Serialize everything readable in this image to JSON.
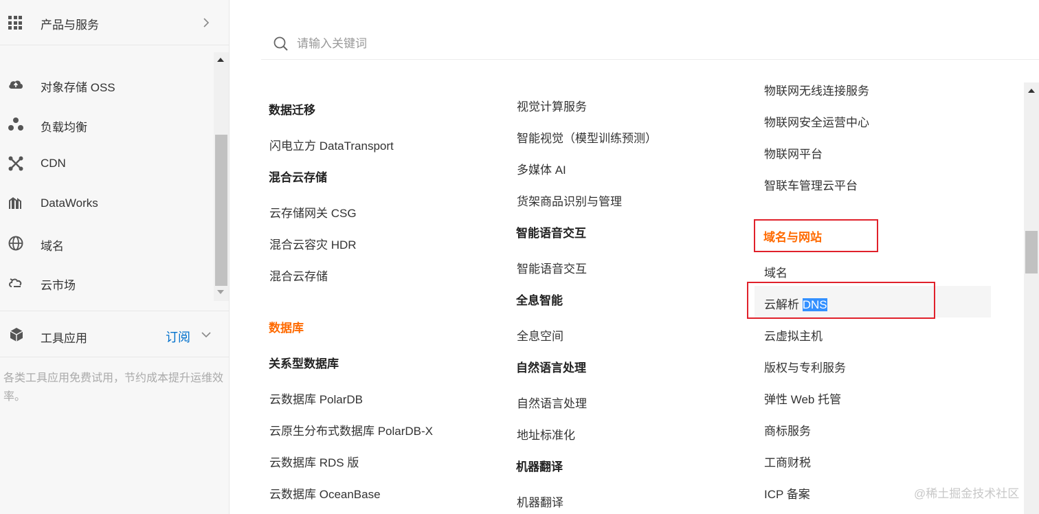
{
  "sidebar": {
    "header_title": "产品与服务",
    "items": [
      {
        "label": "对象存储 OSS",
        "icon": "cloud-icon"
      },
      {
        "label": "负载均衡",
        "icon": "load-balancer-icon"
      },
      {
        "label": "CDN",
        "icon": "cdn-icon"
      },
      {
        "label": "DataWorks",
        "icon": "dataworks-icon"
      },
      {
        "label": "域名",
        "icon": "globe-icon"
      },
      {
        "label": "云市场",
        "icon": "cloud-market-icon"
      }
    ],
    "tools": {
      "label": "工具应用",
      "subscribe": "订阅",
      "description": "各类工具应用免费试用，节约成本提升运维效率。"
    }
  },
  "search": {
    "placeholder": "请输入关键词"
  },
  "columns": {
    "col1": [
      "数据迁移",
      "闪电立方 DataTransport",
      "混合云存储",
      "云存储网关 CSG",
      "混合云容灾 HDR",
      "混合云存储",
      "数据库",
      "关系型数据库",
      "云数据库 PolarDB",
      "云原生分布式数据库 PolarDB-X",
      "云数据库 RDS 版",
      "云数据库 OceanBase"
    ],
    "col2": [
      "视觉计算服务",
      "智能视觉（模型训练预测）",
      "多媒体 AI",
      "货架商品识别与管理",
      "智能语音交互",
      "智能语音交互",
      "全息智能",
      "全息空间",
      "自然语言处理",
      "自然语言处理",
      "地址标准化",
      "机器翻译",
      "机器翻译"
    ],
    "col3": [
      "物联网无线连接服务",
      "物联网安全运营中心",
      "物联网平台",
      "智联车管理云平台",
      "域名与网站",
      "域名",
      "云解析 ",
      "云虚拟主机",
      "版权与专利服务",
      "弹性 Web 托管",
      "商标服务",
      "工商财税",
      "ICP 备案"
    ],
    "selected_text": "DNS"
  },
  "watermark": "@稀土掘金技术社区",
  "colors": {
    "accent_orange": "#ff6a00",
    "link_blue": "#0070cc",
    "highlight_red": "#e0202a",
    "selection_blue": "#3390ff"
  }
}
